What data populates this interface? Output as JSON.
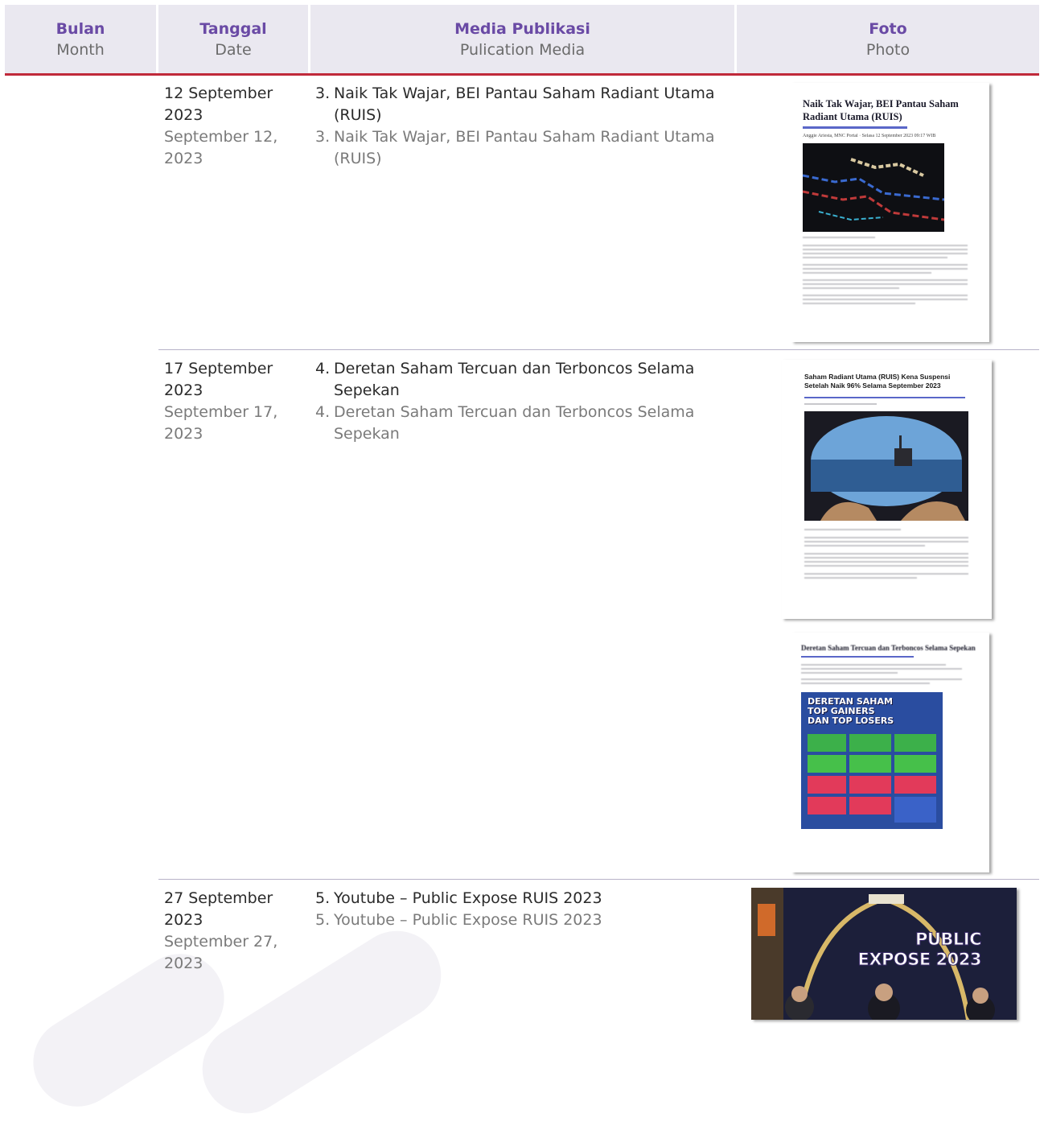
{
  "header": {
    "col1": {
      "main": "Bulan",
      "sub": "Month"
    },
    "col2": {
      "main": "Tanggal",
      "sub": "Date"
    },
    "col3": {
      "main": "Media Publikasi",
      "sub": "Pulication Media"
    },
    "col4": {
      "main": "Foto",
      "sub": "Photo"
    }
  },
  "rows": [
    {
      "date_id": "12 September 2023",
      "date_en": "September 12, 2023",
      "number": "3.",
      "media_id": "Naik Tak Wajar, BEI Pantau Saham Radiant Utama (RUIS)",
      "media_en": "Naik Tak Wajar, BEI Pantau Saham Radiant Utama (RUIS)",
      "photo": {
        "title": "Naik Tak Wajar, BEI Pantau Saham Radiant Utama (RUIS)",
        "byline": "Anggie Ariesta, MNC Portal · Selasa 12 September 2023 09:17 WIB"
      }
    },
    {
      "date_id": "17 September 2023",
      "date_en": "September 17, 2023",
      "number": "4.",
      "media_id": "Deretan Saham Tercuan dan Terboncos Selama Sepekan",
      "media_en": "Deretan Saham Tercuan dan Terboncos Selama Sepekan",
      "photo": {
        "title": "Saham Radiant Utama (RUIS) Kena Suspensi Setelah Naik 96% Selama September 2023",
        "title2": "Deretan Saham Tercuan dan Terboncos Selama Sepekan",
        "infographic": "DERETAN SAHAM TOP GAINERS DAN TOP LOSERS"
      }
    },
    {
      "date_id": "27 September 2023",
      "date_en": "September 27, 2023",
      "number": "5.",
      "media_id": "Youtube – Public Expose RUIS 2023",
      "media_en": "Youtube – Public Expose RUIS 2023",
      "photo": {
        "title": "PUBLIC EXPOSE 2023"
      }
    }
  ],
  "colors": {
    "accent": "#6a4aa5",
    "header_bg": "#eae8f0",
    "rule": "#c0293a"
  }
}
